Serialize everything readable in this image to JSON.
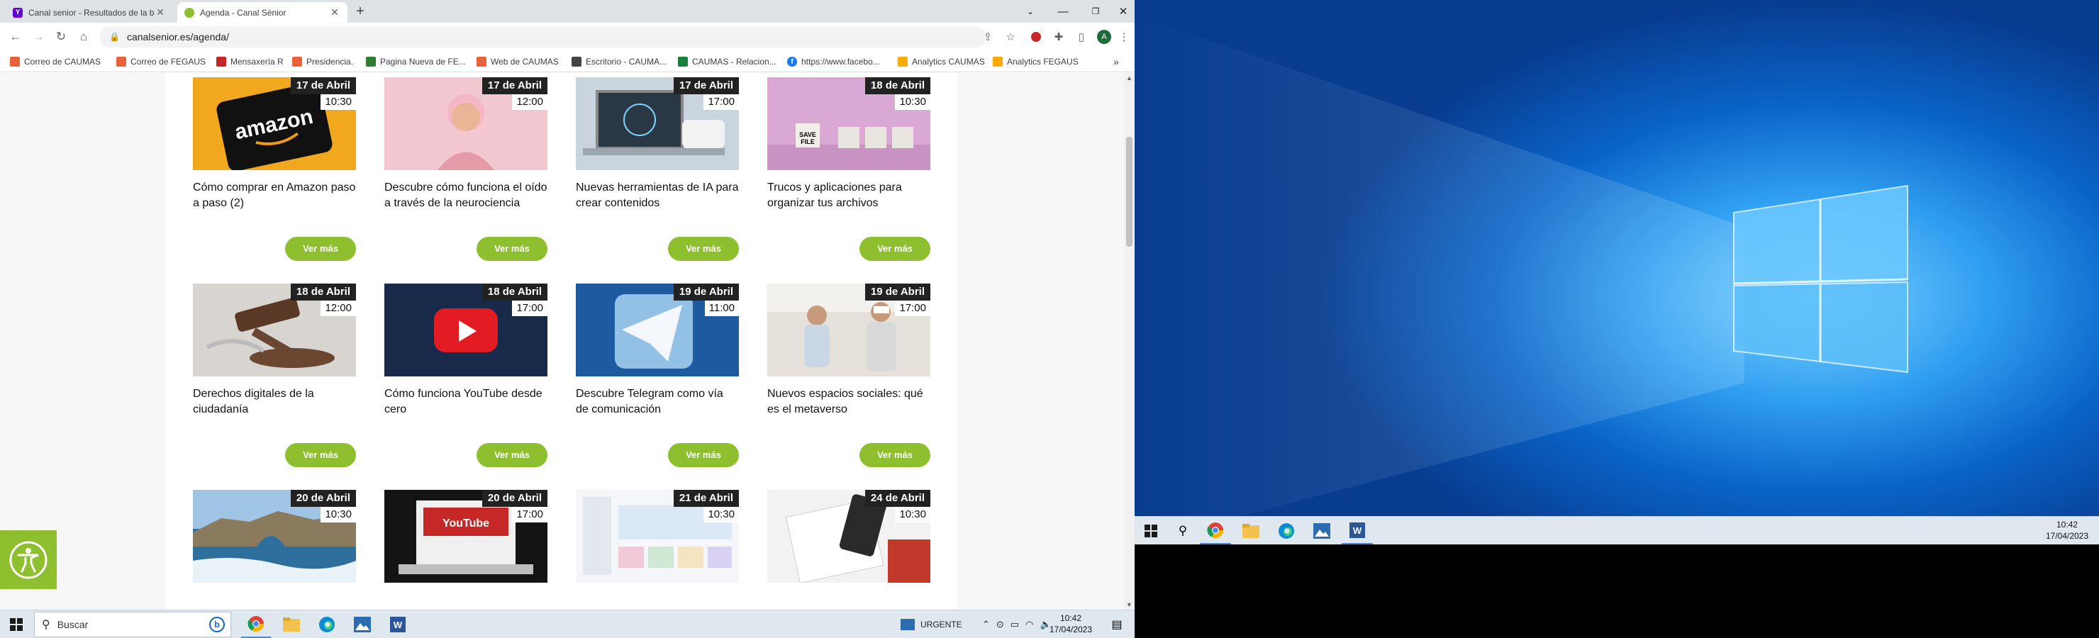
{
  "browser": {
    "tabs": [
      {
        "title": "Canal senior - Resultados de la b",
        "active": false,
        "favicon_color": "#6001d2"
      },
      {
        "title": "Agenda - Canal Sénior",
        "active": true,
        "favicon_color": "#8dbf2e"
      }
    ],
    "new_tab_label": "+",
    "url": "canalsenior.es/agenda/",
    "profile_initial": "A",
    "bookmarks": [
      {
        "label": "Correo de CAUMAS",
        "icon": "mail-icon",
        "color": "#e8623a"
      },
      {
        "label": "Correo de FEGAUS",
        "icon": "mail-icon",
        "color": "#e8623a"
      },
      {
        "label": "Mensaxería R",
        "icon": "bookmark-icon",
        "color": "#c62828"
      },
      {
        "label": "Presidencia.",
        "icon": "mail-icon",
        "color": "#e8623a"
      },
      {
        "label": "Pagina Nueva de FE...",
        "icon": "leaf-icon",
        "color": "#2e7d32"
      },
      {
        "label": "Web de CAUMAS",
        "icon": "globe-icon",
        "color": "#e8623a"
      },
      {
        "label": "Escritorio - CAUMA...",
        "icon": "gear-icon",
        "color": "#444444"
      },
      {
        "label": "CAUMAS - Relacion...",
        "icon": "sheet-icon",
        "color": "#188038"
      },
      {
        "label": "https://www.facebo...",
        "icon": "facebook-icon",
        "color": "#1877f2"
      },
      {
        "label": "Analytics CAUMAS",
        "icon": "analytics-icon",
        "color": "#f9ab00"
      },
      {
        "label": "Analytics FEGAUS",
        "icon": "analytics-icon",
        "color": "#f9ab00"
      }
    ],
    "bookmarks_overflow": "»"
  },
  "agenda": {
    "more_label": "Ver más",
    "cards": [
      {
        "date": "17 de Abril",
        "time": "10:30",
        "title": "Cómo comprar en Amazon paso a paso (2)",
        "image": "amazon-image"
      },
      {
        "date": "17 de Abril",
        "time": "12:00",
        "title": "Descubre cómo funciona el oído a través de la neurociencia",
        "image": "woman-listening-image"
      },
      {
        "date": "17 de Abril",
        "time": "17:00",
        "title": "Nuevas herramientas de IA para crear contenidos",
        "image": "robot-laptop-image"
      },
      {
        "date": "18 de Abril",
        "time": "10:30",
        "title": "Trucos y aplicaciones para organizar tus archivos",
        "image": "save-file-blocks-image"
      },
      {
        "date": "18 de Abril",
        "time": "12:00",
        "title": "Derechos digitales de la ciudadanía",
        "image": "gavel-image"
      },
      {
        "date": "18 de Abril",
        "time": "17:00",
        "title": "Cómo funciona YouTube desde cero",
        "image": "youtube-logo-image"
      },
      {
        "date": "19 de Abril",
        "time": "11:00",
        "title": "Descubre Telegram como vía de comunicación",
        "image": "telegram-image"
      },
      {
        "date": "19 de Abril",
        "time": "17:00",
        "title": "Nuevos espacios sociales: qué es el metaverso",
        "image": "vr-headset-image"
      },
      {
        "date": "20 de Abril",
        "time": "10:30",
        "title": "",
        "image": "coast-image"
      },
      {
        "date": "20 de Abril",
        "time": "17:00",
        "title": "",
        "image": "laptop-youtube-image"
      },
      {
        "date": "21 de Abril",
        "time": "10:30",
        "title": "",
        "image": "design-app-image"
      },
      {
        "date": "24 de Abril",
        "time": "10:30",
        "title": "",
        "image": "reading-document-image"
      }
    ]
  },
  "taskbar": {
    "search_placeholder": "Buscar",
    "notification_label": "URGENTE",
    "time": "10:42",
    "date": "17/04/2023"
  },
  "taskbar2": {
    "time": "10:42",
    "date": "17/04/2023"
  }
}
